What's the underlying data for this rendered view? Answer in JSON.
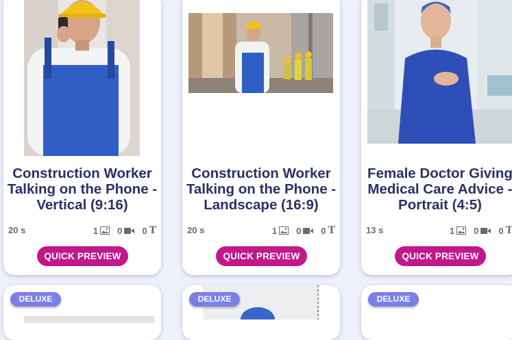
{
  "quick_preview_label": "QUICK PREVIEW",
  "cards": [
    {
      "title": "Construction Worker Talking on the Phone - Vertical (9:16)",
      "duration": "20 s",
      "images": "1",
      "videos": "0",
      "texts": "0"
    },
    {
      "title": "Construction Worker Talking on the Phone - Landscape (16:9)",
      "duration": "20 s",
      "images": "1",
      "videos": "0",
      "texts": "0"
    },
    {
      "title": "Female Doctor Giving Medical Care Advice - Portrait (4:5)",
      "duration": "13 s",
      "images": "1",
      "videos": "0",
      "texts": "0"
    }
  ],
  "bottom_badges": [
    "DELUXE",
    "DELUXE",
    "DELUXE"
  ],
  "colors": {
    "accent": "#c2188a",
    "title": "#2b2f66",
    "badge": "#7b7fe8",
    "background": "#eef0fb"
  },
  "icons": [
    "image-icon",
    "video-icon",
    "text-icon"
  ]
}
